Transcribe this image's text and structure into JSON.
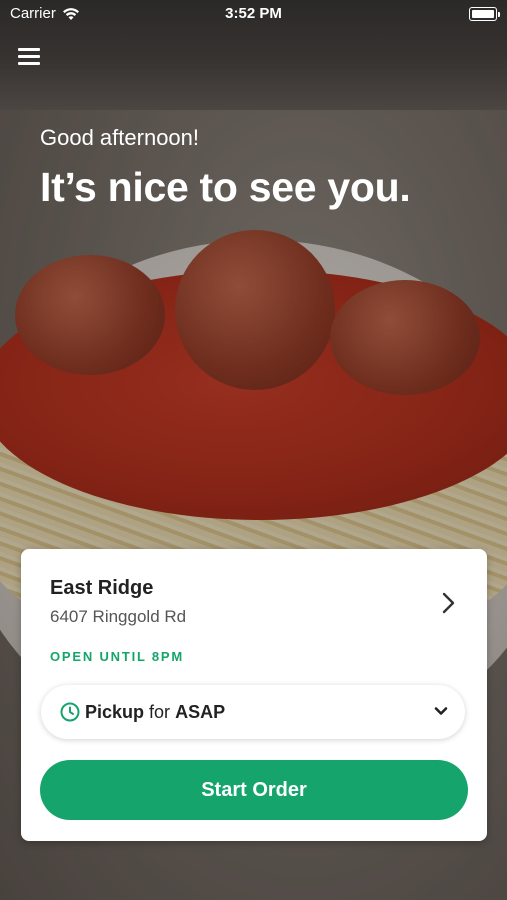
{
  "status_bar": {
    "carrier": "Carrier",
    "time": "3:52 PM",
    "icons": [
      "wifi-icon",
      "battery-icon"
    ]
  },
  "header": {
    "menu_icon": "hamburger-menu-icon"
  },
  "greeting": {
    "subtitle": "Good afternoon!",
    "title": "It’s nice to see you."
  },
  "location_card": {
    "name": "East Ridge",
    "address": "6407 Ringgold Rd",
    "hours_status": "OPEN UNTIL 8PM",
    "order_type": "Pickup",
    "for_text": "for",
    "when": "ASAP",
    "start_order_label": "Start Order"
  },
  "colors": {
    "accent_green": "#15A56C",
    "open_text_green": "#14A56B",
    "card_bg": "#FFFFFF"
  }
}
